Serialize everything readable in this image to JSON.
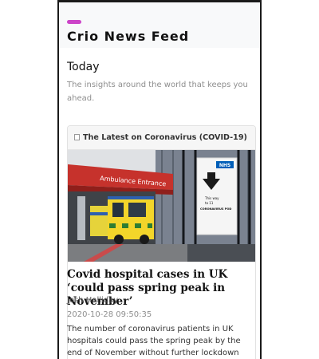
{
  "app": {
    "title": "Crio News Feed",
    "accent_color": "#cc44c8"
  },
  "section": {
    "title": "Today",
    "subtitle": "The insights around the world that keeps you ahead."
  },
  "card": {
    "header_icon": "broken-image-icon",
    "header_title": "The Latest on Coronavirus (COVID-19)",
    "image_icon": "news-photo",
    "image_text": {
      "ambulance_sign": "Ambulance Entrance",
      "nhs_logo": "NHS",
      "poster_line1": "This way",
      "poster_line2": "to 11",
      "poster_line3": "CORONAVIRUS POD"
    },
    "article": {
      "title": "Covid hospital cases in UK ‘could pass spring peak in November’",
      "author": "Josh Halliday",
      "date": "2020-10-28 09:50:35",
      "body": "The number of coronavirus patients in UK hospitals could pass the spring peak by the end of November without further lockdown"
    }
  }
}
